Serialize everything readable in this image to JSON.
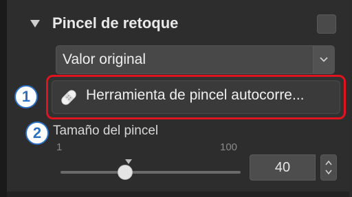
{
  "section": {
    "title": "Pincel de retoque",
    "enabled": false
  },
  "dropdown": {
    "selected": "Valor original"
  },
  "tool": {
    "label": "Herramienta de pincel autocorre..."
  },
  "callouts": {
    "one": "1",
    "two": "2"
  },
  "brush_size": {
    "label": "Tamaño del pincel",
    "min_label": "1",
    "max_label": "100",
    "value": "40",
    "fraction": 0.36
  },
  "colors": {
    "highlight_frame": "#e0141e",
    "callout_accent": "#2d6fc1",
    "panel_bg": "#2d2d2d"
  },
  "icons": {
    "collapse": "triangle-down-icon",
    "dropdown": "chevron-down-icon",
    "tool": "bandage-icon",
    "stepper": "up-down-arrows-icon"
  }
}
